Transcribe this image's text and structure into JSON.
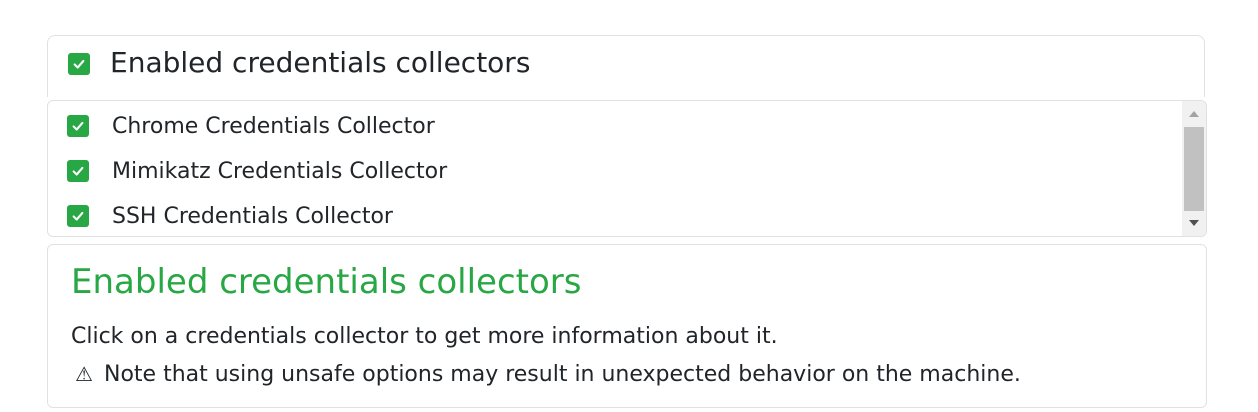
{
  "header": {
    "title": "Enabled credentials collectors",
    "checked": true
  },
  "collectors": [
    {
      "label": "Chrome Credentials Collector",
      "checked": true
    },
    {
      "label": "Mimikatz Credentials Collector",
      "checked": true
    },
    {
      "label": "SSH Credentials Collector",
      "checked": true
    }
  ],
  "info": {
    "title": "Enabled credentials collectors",
    "description": "Click on a credentials collector to get more information about it.",
    "warning_icon": "⚠",
    "warning": "Note that using unsafe options may result in unexpected behavior on the machine."
  },
  "colors": {
    "accent": "#28a745",
    "border": "#dee2e6"
  }
}
